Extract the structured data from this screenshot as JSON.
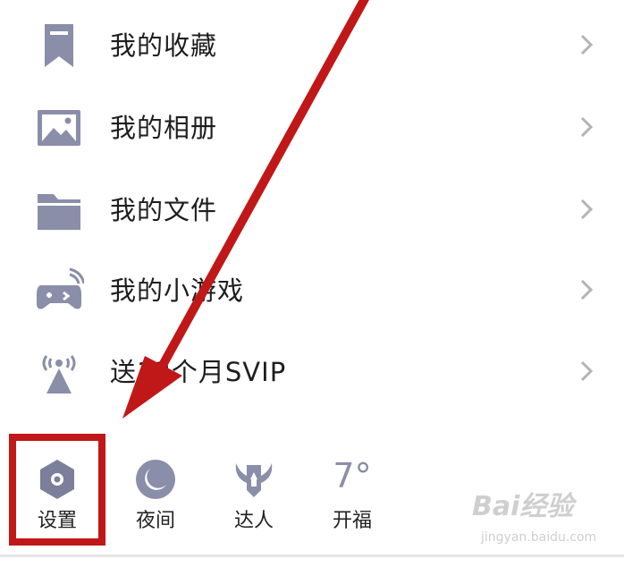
{
  "menu": {
    "items": [
      {
        "label": "我的收藏",
        "icon": "bookmark-icon"
      },
      {
        "label": "我的相册",
        "icon": "image-icon"
      },
      {
        "label": "我的文件",
        "icon": "folder-icon"
      },
      {
        "label": "我的小游戏",
        "icon": "gamepad-icon"
      },
      {
        "label": "送12个月SVIP",
        "icon": "broadcast-tower-icon"
      }
    ]
  },
  "bottom_bar": {
    "items": [
      {
        "label": "设置",
        "icon": "hexagon-settings-icon"
      },
      {
        "label": "夜间",
        "icon": "moon-icon"
      },
      {
        "label": "达人",
        "icon": "winged-badge-icon"
      },
      {
        "label": "开福",
        "icon": "weather-temperature",
        "value": "7°"
      }
    ]
  },
  "annotation": {
    "color": "#c01818",
    "highlighted_item": "设置"
  },
  "watermark": {
    "brand": "Bai经验",
    "domain": "jingyan.baidu.com"
  },
  "colors": {
    "icon": "#8a8ea8",
    "icon_dark": "#7b7f99",
    "chevron": "#b4b4b4"
  }
}
